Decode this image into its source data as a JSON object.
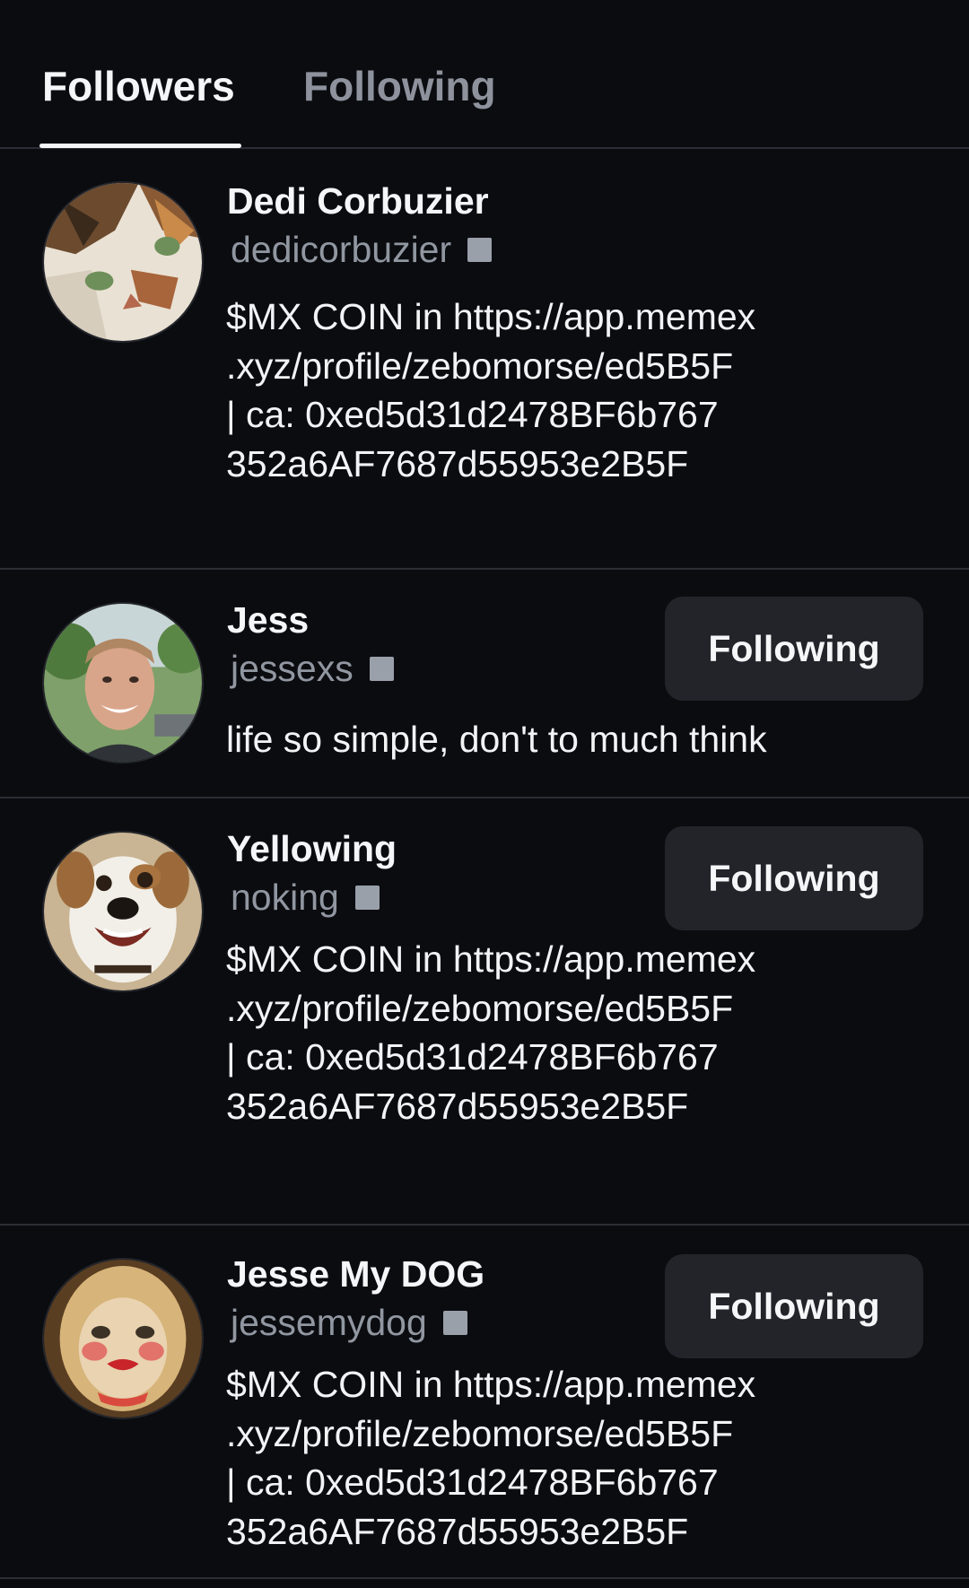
{
  "tabs": {
    "followers_label": "Followers",
    "following_label": "Following",
    "active": "followers"
  },
  "users": [
    {
      "name": "Dedi Corbuzier",
      "handle": "dedicorbuzier",
      "bio": "$MX COIN in https://app.memex\n.xyz/profile/zebomorse/ed5B5F\n| ca: 0xed5d31d2478BF6b767\n352a6AF7687d55953e2B5F",
      "avatar_icon": "calico-cat-avatar",
      "button_label": ""
    },
    {
      "name": "Jess",
      "handle": "jessexs",
      "bio": "life so simple, don't to much think",
      "avatar_icon": "person-photo-avatar",
      "button_label": "Following"
    },
    {
      "name": "Yellowing",
      "handle": "noking",
      "bio": "$MX COIN in https://app.memex\n.xyz/profile/zebomorse/ed5B5F\n| ca: 0xed5d31d2478BF6b767\n352a6AF7687d55953e2B5F",
      "avatar_icon": "cartoon-dog-avatar",
      "button_label": "Following"
    },
    {
      "name": "Jesse My DOG",
      "handle": "jessemydog",
      "bio": "$MX COIN in https://app.memex\n.xyz/profile/zebomorse/ed5B5F\n| ca: 0xed5d31d2478BF6b767\n352a6AF7687d55953e2B5F",
      "avatar_icon": "makeup-cat-avatar",
      "button_label": "Following"
    }
  ],
  "colors": {
    "background": "#0b0c10",
    "divider": "#2c2e35",
    "button_bg": "#22242a",
    "muted_text": "#9197a1",
    "badge": "#9aa0aa"
  }
}
